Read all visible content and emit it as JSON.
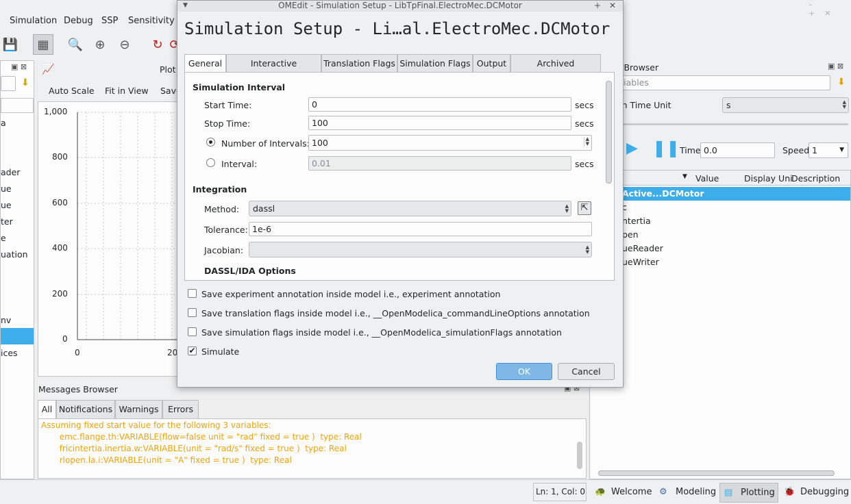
{
  "menubar": {
    "items": [
      "Simulation",
      "Debug",
      "SSP",
      "Sensitivity O"
    ]
  },
  "plot": {
    "tab_label": "Plot",
    "buttons": {
      "auto_scale": "Auto Scale",
      "fit_in_view": "Fit in View",
      "save": "Save"
    },
    "y_ticks": [
      "1,000",
      "800",
      "600",
      "400",
      "200",
      "0"
    ],
    "x_ticks": [
      "0",
      "20"
    ]
  },
  "left_list": [
    "a",
    "ader",
    "ue",
    "ue",
    "ter",
    "e",
    "uation",
    "nv",
    "ices"
  ],
  "variables_browser": {
    "title": "s Browser",
    "filter_placeholder": "riables",
    "time_unit_label": "on Time Unit",
    "time_unit_value": "s",
    "time_label": "Time:",
    "time_value": "0.0",
    "speed_label": "Speed:",
    "speed_value": "1",
    "columns": [
      "s",
      "Value",
      "Display Uni",
      "Description"
    ],
    "rows": [
      "Active...DCMotor",
      "c",
      "ntertia",
      "pen",
      "ueReader",
      "ueWriter"
    ]
  },
  "messages": {
    "title": "Messages Browser",
    "tabs": [
      "All",
      "Notifications",
      "Warnings",
      "Errors"
    ],
    "lines": [
      "Assuming fixed start value for the following 3 variables:",
      "       emc.flange.th:VARIABLE(flow=false unit = \"rad\" fixed = true )  type: Real",
      "       fricintertia.inertia.w:VARIABLE(unit = \"rad/s\" fixed = true )  type: Real",
      "       rlopen.la.i:VARIABLE(unit = \"A\" fixed = true )  type: Real"
    ]
  },
  "statusbar": {
    "position": "Ln: 1, Col: 0"
  },
  "perspectives": {
    "welcome": "Welcome",
    "modeling": "Modeling",
    "plotting": "Plotting",
    "debugging": "Debugging"
  },
  "dialog": {
    "window_title": "OMEdit - Simulation Setup - LibTpFinal.ElectroMec.DCMotor",
    "heading": "Simulation Setup - Li…al.ElectroMec.DCMotor",
    "tabs": [
      "General",
      "Interactive Simulation",
      "Translation Flags",
      "Simulation Flags",
      "Output",
      "Archived Simulations"
    ],
    "interval": {
      "section": "Simulation Interval",
      "start_label": "Start Time:",
      "start_value": "0",
      "stop_label": "Stop Time:",
      "stop_value": "100",
      "num_label": "Number of Intervals:",
      "num_value": "100",
      "interval_label": "Interval:",
      "interval_value": "0.01",
      "unit": "secs"
    },
    "integration": {
      "section": "Integration",
      "method_label": "Method:",
      "method_value": "dassl",
      "tolerance_label": "Tolerance:",
      "tolerance_value": "1e-6",
      "jacobian_label": "Jacobian:",
      "jacobian_value": "",
      "dassl_section": "DASSL/IDA Options"
    },
    "checkboxes": [
      "Save experiment annotation inside model i.e., experiment annotation",
      "Save translation flags inside model i.e., __OpenModelica_commandLineOptions annotation",
      "Save simulation flags inside model i.e., __OpenModelica_simulationFlags annotation",
      "Simulate"
    ],
    "ok": "OK",
    "cancel": "Cancel"
  },
  "colors": {
    "accent": "#3daee9",
    "warning_text": "#f0a30a",
    "selection": "#3daee9"
  }
}
